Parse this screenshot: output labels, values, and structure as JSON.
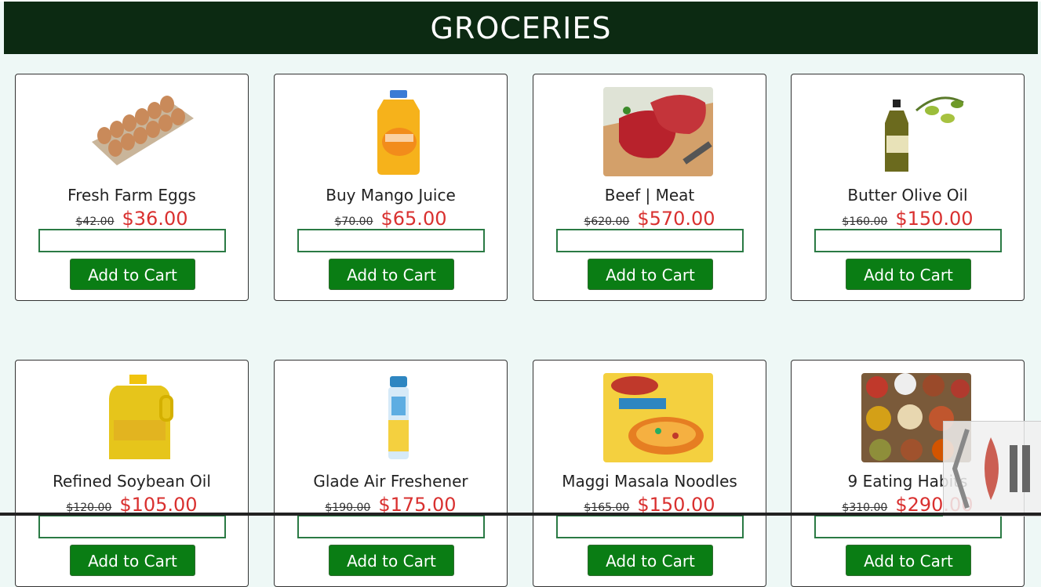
{
  "header": {
    "title": "GROCERIES"
  },
  "add_to_cart_label": "Add to Cart",
  "products": [
    {
      "name": "Fresh Farm Eggs",
      "old_price": "$42.00",
      "price": "$36.00"
    },
    {
      "name": "Buy Mango Juice",
      "old_price": "$70.00",
      "price": "$65.00"
    },
    {
      "name": "Beef | Meat",
      "old_price": "$620.00",
      "price": "$570.00"
    },
    {
      "name": "Butter Olive Oil",
      "old_price": "$160.00",
      "price": "$150.00"
    },
    {
      "name": "Refined Soybean Oil",
      "old_price": "$120.00",
      "price": "$105.00"
    },
    {
      "name": "Glade Air Freshener",
      "old_price": "$190.00",
      "price": "$175.00"
    },
    {
      "name": "Maggi Masala Noodles",
      "old_price": "$165.00",
      "price": "$150.00"
    },
    {
      "name": "9 Eating Habits",
      "old_price": "$310.00",
      "price": "$290.00"
    }
  ]
}
